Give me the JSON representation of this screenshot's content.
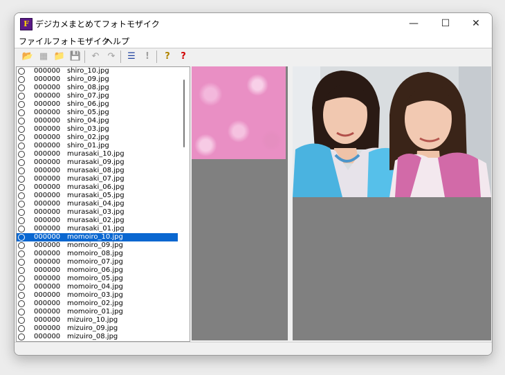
{
  "window": {
    "title": "デジカメまとめてフォトモザイク",
    "icon_letter": "F",
    "controls": {
      "minimize": "—",
      "maximize": "☐",
      "close": "✕"
    }
  },
  "menu": [
    "ファイル",
    "フォトモザイク",
    "ヘルプ"
  ],
  "toolbar": {
    "buttons": [
      {
        "name": "open-folder-icon",
        "glyph": "📂",
        "enabled": true
      },
      {
        "name": "thumbnail-icon",
        "glyph": "▦",
        "enabled": false
      },
      {
        "name": "folder-icon",
        "glyph": "📁",
        "enabled": true
      },
      {
        "name": "save-icon",
        "glyph": "💾",
        "enabled": false
      },
      {
        "name": "undo-icon",
        "glyph": "↶",
        "enabled": false
      },
      {
        "name": "redo-icon",
        "glyph": "↷",
        "enabled": false
      },
      {
        "name": "list-icon",
        "glyph": "☰",
        "enabled": true
      },
      {
        "name": "exclamation-icon",
        "glyph": "!",
        "enabled": false
      },
      {
        "name": "help-icon",
        "glyph": "?",
        "enabled": true
      },
      {
        "name": "help-red-icon",
        "glyph": "?",
        "enabled": true
      }
    ]
  },
  "file_list": [
    {
      "count": "000000",
      "name": "shiro_10.jpg"
    },
    {
      "count": "000000",
      "name": "shiro_09.jpg"
    },
    {
      "count": "000000",
      "name": "shiro_08.jpg"
    },
    {
      "count": "000000",
      "name": "shiro_07.jpg"
    },
    {
      "count": "000000",
      "name": "shiro_06.jpg"
    },
    {
      "count": "000000",
      "name": "shiro_05.jpg"
    },
    {
      "count": "000000",
      "name": "shiro_04.jpg"
    },
    {
      "count": "000000",
      "name": "shiro_03.jpg"
    },
    {
      "count": "000000",
      "name": "shiro_02.jpg"
    },
    {
      "count": "000000",
      "name": "shiro_01.jpg"
    },
    {
      "count": "000000",
      "name": "murasaki_10.jpg"
    },
    {
      "count": "000000",
      "name": "murasaki_09.jpg"
    },
    {
      "count": "000000",
      "name": "murasaki_08.jpg"
    },
    {
      "count": "000000",
      "name": "murasaki_07.jpg"
    },
    {
      "count": "000000",
      "name": "murasaki_06.jpg"
    },
    {
      "count": "000000",
      "name": "murasaki_05.jpg"
    },
    {
      "count": "000000",
      "name": "murasaki_04.jpg"
    },
    {
      "count": "000000",
      "name": "murasaki_03.jpg"
    },
    {
      "count": "000000",
      "name": "murasaki_02.jpg"
    },
    {
      "count": "000000",
      "name": "murasaki_01.jpg"
    },
    {
      "count": "000000",
      "name": "momoiro_10.jpg",
      "selected": true
    },
    {
      "count": "000000",
      "name": "momoiro_09.jpg"
    },
    {
      "count": "000000",
      "name": "momoiro_08.jpg"
    },
    {
      "count": "000000",
      "name": "momoiro_07.jpg"
    },
    {
      "count": "000000",
      "name": "momoiro_06.jpg"
    },
    {
      "count": "000000",
      "name": "momoiro_05.jpg"
    },
    {
      "count": "000000",
      "name": "momoiro_04.jpg"
    },
    {
      "count": "000000",
      "name": "momoiro_03.jpg"
    },
    {
      "count": "000000",
      "name": "momoiro_02.jpg"
    },
    {
      "count": "000000",
      "name": "momoiro_01.jpg"
    },
    {
      "count": "000000",
      "name": "mizuiro_10.jpg"
    },
    {
      "count": "000000",
      "name": "mizuiro_09.jpg"
    },
    {
      "count": "000000",
      "name": "mizuiro_08.jpg"
    }
  ],
  "colors": {
    "selection": "#0a67d0",
    "pane_background": "#808080",
    "tile_pink": "#e98fc4"
  }
}
